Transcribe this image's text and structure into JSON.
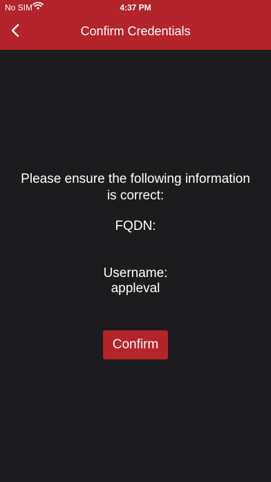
{
  "status_bar": {
    "carrier": "No SIM",
    "time": "4:37 PM"
  },
  "nav": {
    "title": "Confirm Credentials",
    "back_icon": "chevron-left-icon"
  },
  "main": {
    "prompt": "Please ensure the following information is correct:",
    "fqdn_label": "FQDN:",
    "fqdn_value": "",
    "username_label": "Username:",
    "username_value": "appleval",
    "confirm_label": "Confirm"
  },
  "colors": {
    "accent": "#b3242b",
    "background": "#1c1c1e",
    "text": "#ffffff"
  }
}
